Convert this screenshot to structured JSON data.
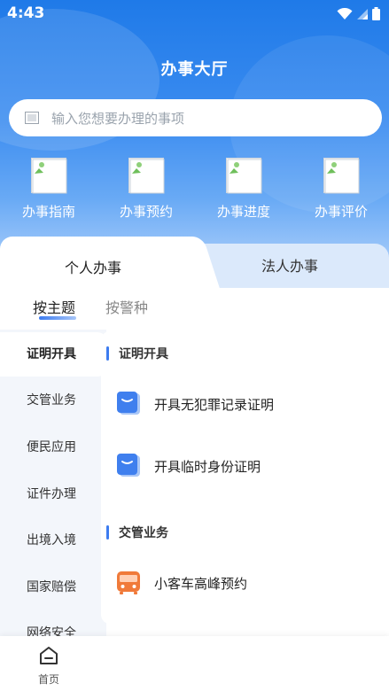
{
  "status_bar": {
    "time": "4:43"
  },
  "header": {
    "title": "办事大厅"
  },
  "search": {
    "placeholder": "输入您想要办理的事项"
  },
  "quick_actions": [
    {
      "label": "办事指南",
      "icon": "broken-image-icon"
    },
    {
      "label": "办事预约",
      "icon": "broken-image-icon"
    },
    {
      "label": "办事进度",
      "icon": "broken-image-icon"
    },
    {
      "label": "办事评价",
      "icon": "broken-image-icon"
    }
  ],
  "tabs": [
    {
      "label": "个人办事",
      "active": true
    },
    {
      "label": "法人办事",
      "active": false
    }
  ],
  "subtabs": [
    {
      "label": "按主题",
      "active": true
    },
    {
      "label": "按警种",
      "active": false
    }
  ],
  "sidebar": {
    "items": [
      {
        "label": "证明开具",
        "active": true
      },
      {
        "label": "交管业务"
      },
      {
        "label": "便民应用"
      },
      {
        "label": "证件办理"
      },
      {
        "label": "出境入境"
      },
      {
        "label": "国家赔偿"
      },
      {
        "label": "网络安全"
      }
    ]
  },
  "sections": [
    {
      "title": "证明开具",
      "items": [
        {
          "label": "开具无犯罪记录证明",
          "icon": "certificate-icon"
        },
        {
          "label": "开具临时身份证明",
          "icon": "certificate-icon"
        }
      ]
    },
    {
      "title": "交管业务",
      "items": [
        {
          "label": "小客车高峰预约",
          "icon": "bus-icon"
        }
      ]
    }
  ],
  "bottom_nav": {
    "home_label": "首页"
  },
  "colors": {
    "accent": "#3d7cf0",
    "hero_top": "#1f7ae8",
    "bus_icon": "#f07a3a"
  }
}
